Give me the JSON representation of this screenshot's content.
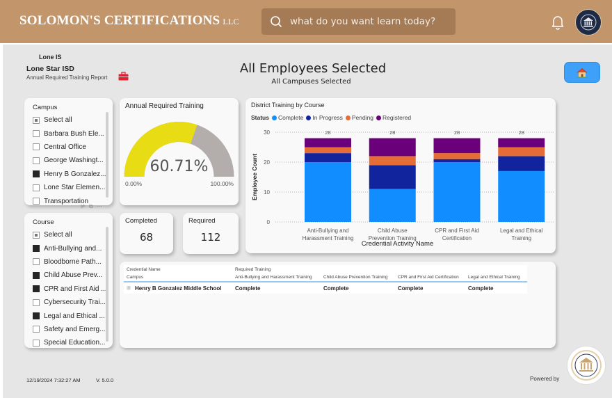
{
  "topbar": {
    "brand": "SOLOMON'S CERTIFICATIONS",
    "brand_suffix": "LLC",
    "search_placeholder": "what do you want learn today?",
    "icons": [
      "search-icon",
      "bell-icon",
      "avatar-logo"
    ]
  },
  "report": {
    "org_short": "Lone IS",
    "org_name": "Lone Star ISD",
    "report_name": "Annual Required Training Report",
    "title": "All Employees Selected",
    "subtitle": "All Campuses Selected",
    "home_icon": "home-icon"
  },
  "campus_slicer": {
    "title": "Campus",
    "items": [
      {
        "label": "Select all",
        "state": "partial"
      },
      {
        "label": "Barbara Bush Ele...",
        "state": "unchecked"
      },
      {
        "label": "Central Office",
        "state": "unchecked"
      },
      {
        "label": "George Washingt...",
        "state": "unchecked"
      },
      {
        "label": "Henry B Gonzalez...",
        "state": "checked"
      },
      {
        "label": "Lone Star Elemen...",
        "state": "unchecked"
      },
      {
        "label": "Transportation",
        "state": "unchecked"
      }
    ]
  },
  "course_slicer": {
    "title": "Course",
    "items": [
      {
        "label": "Select all",
        "state": "partial"
      },
      {
        "label": "Anti-Bullying and...",
        "state": "checked"
      },
      {
        "label": "Bloodborne Path...",
        "state": "unchecked"
      },
      {
        "label": "Child Abuse Prev...",
        "state": "checked"
      },
      {
        "label": "CPR and First Aid ...",
        "state": "checked"
      },
      {
        "label": "Cybersecurity Trai...",
        "state": "unchecked"
      },
      {
        "label": "Legal and Ethical ...",
        "state": "checked"
      },
      {
        "label": "Safety and Emerg...",
        "state": "unchecked"
      },
      {
        "label": "Special Education...",
        "state": "unchecked"
      }
    ]
  },
  "gauge": {
    "title": "Annual Required Training",
    "value_label": "60.71%",
    "value_fraction": 0.6071,
    "min_label": "0.00%",
    "max_label": "100.00%",
    "fill_color": "#e8dc14",
    "track_color": "#b3aeab"
  },
  "kpis": {
    "completed_label": "Completed",
    "completed_value": "68",
    "required_label": "Required",
    "required_value": "112"
  },
  "chart_data": {
    "type": "bar",
    "stacked": true,
    "title": "District Training by Course",
    "legend_title": "Status",
    "legend_position": "top-left",
    "xlabel": "Credential Activity Name",
    "ylabel": "Employee Count",
    "ylim": [
      0,
      30
    ],
    "yticks": [
      0,
      10,
      20,
      30
    ],
    "grid": true,
    "categories": [
      [
        "Anti-Bullying and",
        "Harassment Training"
      ],
      [
        "Child Abuse",
        "Prevention Training"
      ],
      [
        "CPR and First Aid",
        "Certification"
      ],
      [
        "Legal and Ethical",
        "Training"
      ]
    ],
    "totals": [
      28,
      28,
      28,
      28
    ],
    "series": [
      {
        "name": "Complete",
        "color": "#118dff",
        "values": [
          20,
          11,
          20,
          17
        ]
      },
      {
        "name": "In Progress",
        "color": "#12239e",
        "values": [
          3,
          8,
          1,
          5
        ]
      },
      {
        "name": "Pending",
        "color": "#e66c37",
        "values": [
          2,
          3,
          2,
          3
        ]
      },
      {
        "name": "Registered",
        "color": "#6b007b",
        "values": [
          3,
          6,
          5,
          3
        ]
      }
    ]
  },
  "matrix": {
    "header_row1": [
      "Credential Name",
      "Required Training"
    ],
    "header_row2": [
      "Campus",
      "Anti-Bullying and Harassment Training",
      "Child Abuse Prevention Training",
      "CPR and First Aid Certification",
      "Legal and Ethical Training"
    ],
    "rows": [
      {
        "campus": "Henry B Gonzalez Middle School",
        "values": [
          "Complete",
          "Complete",
          "Complete",
          "Complete"
        ]
      }
    ]
  },
  "footer": {
    "timestamp": "12/19/2024 7:32:27 AM",
    "version": "V. 5.0.0",
    "powered_by": "Powered by"
  }
}
